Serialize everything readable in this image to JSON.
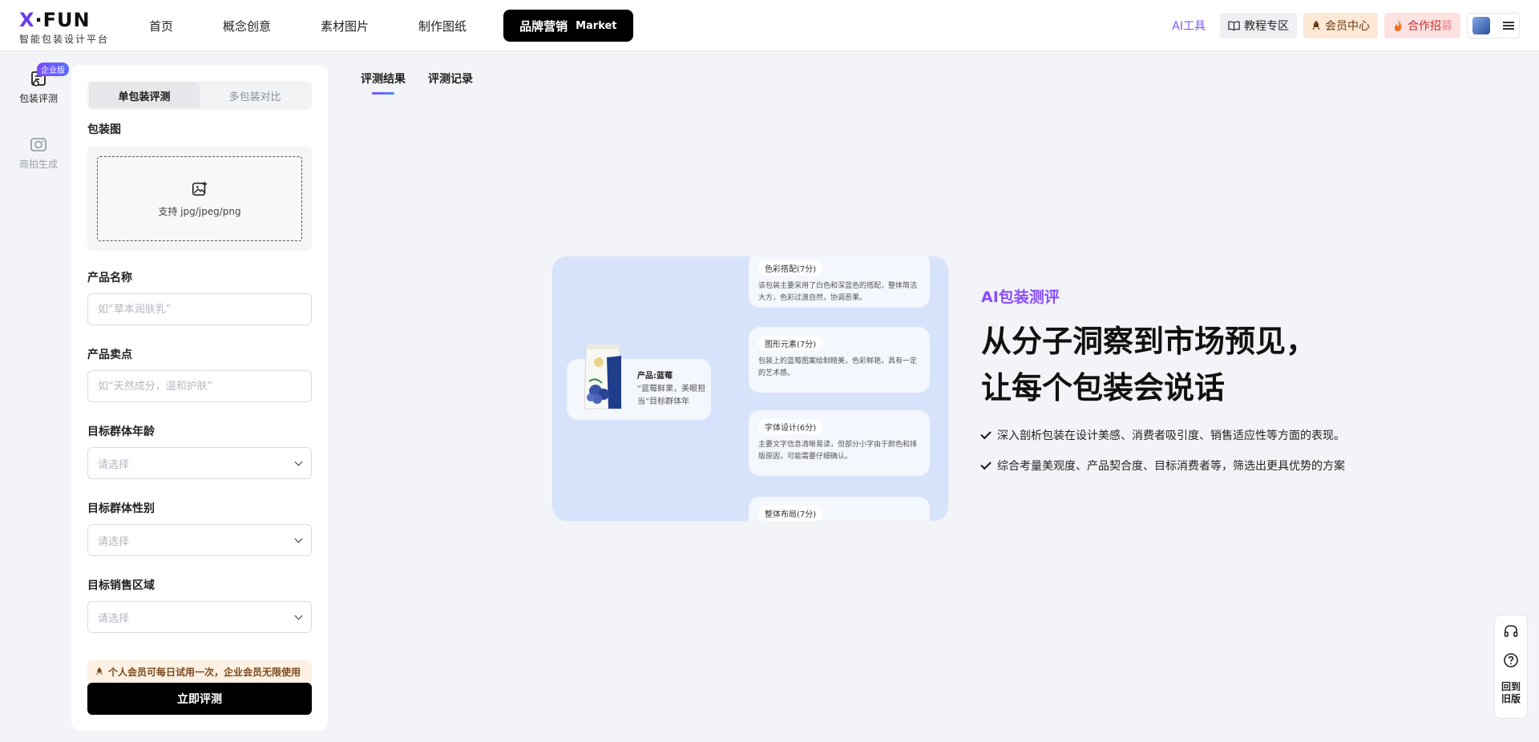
{
  "brand": {
    "logo_text": "X·FUN",
    "logo_sub": "智能包装设计平台"
  },
  "nav": {
    "items": [
      "首页",
      "概念创意",
      "素材图片",
      "制作图纸"
    ],
    "active": {
      "label": "品牌营销",
      "tag": "Market"
    }
  },
  "actions": {
    "ai_tools": "AI工具",
    "course": "教程专区",
    "member": "会员中心",
    "coop_main": "合作招",
    "coop_sub": "募"
  },
  "rail": {
    "items": [
      {
        "label": "包装评测",
        "badge": "企业版",
        "icon": "package-eval-icon"
      },
      {
        "label": "商拍生成",
        "icon": "camera-icon"
      }
    ]
  },
  "panel": {
    "seg_active": "单包装评测",
    "seg_other": "多包装对比",
    "package_label": "包装图",
    "upload_hint": "支持 jpg/jpeg/png",
    "name_label": "产品名称",
    "name_placeholder": "如“草本润肤乳”",
    "sell_label": "产品卖点",
    "sell_placeholder": "如“天然成分，温和护肤”",
    "age_label": "目标群体年龄",
    "gender_label": "目标群体性别",
    "region_label": "目标销售区域",
    "select_placeholder": "请选择",
    "notice": "个人会员可每日试用一次，企业会员无限使用",
    "submit": "立即评测"
  },
  "tabs": {
    "result": "评测结果",
    "history": "评测记录"
  },
  "showcase": {
    "product_title": "产品:蓝莓",
    "product_desc": "“蓝莓鲜果，美眼担当”目标群体年龄:...",
    "cards": [
      {
        "title": "色彩搭配(7分)",
        "text": "该包装主要采用了白色和深蓝色的搭配，整体简洁大方，色彩过渡自然，协调恶果。"
      },
      {
        "title": "图形元素(7分)",
        "text": "包装上的蓝莓图案绘制精美，色彩鲜艳，具有一定的艺术感。"
      },
      {
        "title": "字体设计(6分)",
        "text": "主要文字信息清晰易读，但部分小字由于颜色和排版原因，可能需要仔细确认。"
      },
      {
        "title": "整体布局(7分)",
        "text": ""
      }
    ]
  },
  "hero": {
    "tag": "AI包装测评",
    "line1": "从分子洞察到市场预见，",
    "line2": "让每个包装会说话",
    "bullets": [
      "深入剖析包装在设计美感、消费者吸引度、销售适应性等方面的表现。",
      "综合考量美观度、产品契合度、目标消费者等，筛选出更具优势的方案"
    ]
  },
  "floatbar": {
    "back_line1": "回到",
    "back_line2": "旧版"
  },
  "colors": {
    "accent": "#7a4dff",
    "primary": "#000000",
    "bg": "#f2f4f7"
  }
}
